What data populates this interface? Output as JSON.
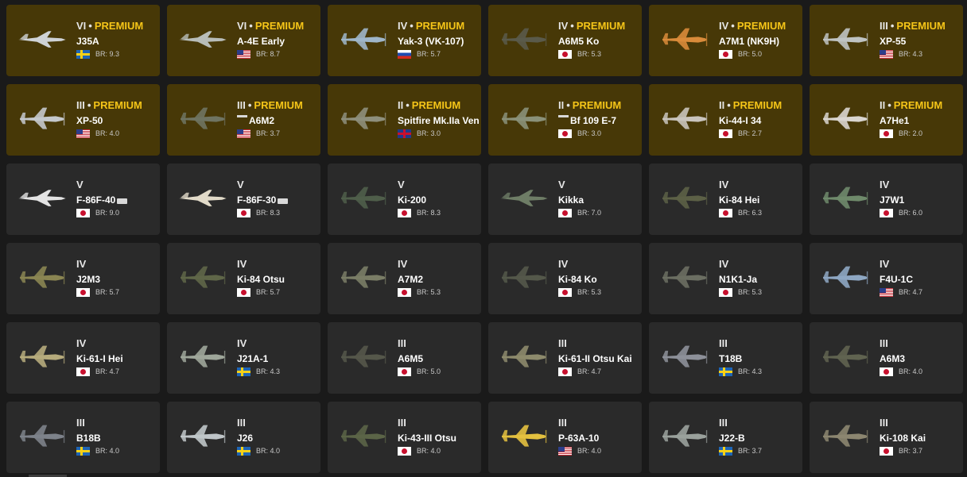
{
  "vehicles": [
    {
      "rank": "VI",
      "premium": true,
      "premium_label": "PREMIUM",
      "name": "J35A",
      "country": "se",
      "br": "BR: 9.3",
      "icon": "jet-aircraft-icon",
      "color": "#cfd3d6"
    },
    {
      "rank": "VI",
      "premium": true,
      "premium_label": "PREMIUM",
      "name": "A-4E Early",
      "country": "us",
      "br": "BR: 8.7",
      "icon": "jet-aircraft-icon",
      "color": "#b8bdb9"
    },
    {
      "rank": "IV",
      "premium": true,
      "premium_label": "PREMIUM",
      "name": "Yak-3 (VK-107)",
      "country": "ru",
      "br": "BR: 5.7",
      "icon": "prop-aircraft-icon",
      "color": "#9fb6c9"
    },
    {
      "rank": "IV",
      "premium": true,
      "premium_label": "PREMIUM",
      "name": "A6M5 Ko",
      "country": "jp",
      "br": "BR: 5.3",
      "icon": "prop-aircraft-icon",
      "color": "#5a5a4a"
    },
    {
      "rank": "IV",
      "premium": true,
      "premium_label": "PREMIUM",
      "name": "A7M1 (NK9H)",
      "country": "jp",
      "br": "BR: 5.0",
      "icon": "prop-aircraft-icon",
      "color": "#d98b3a"
    },
    {
      "rank": "III",
      "premium": true,
      "premium_label": "PREMIUM",
      "name": "XP-55",
      "country": "us",
      "br": "BR: 4.3",
      "icon": "prop-aircraft-icon",
      "color": "#bfc3c2"
    },
    {
      "rank": "III",
      "premium": true,
      "premium_label": "PREMIUM",
      "name": "XP-50",
      "country": "us",
      "br": "BR: 4.0",
      "icon": "prop-aircraft-icon",
      "color": "#c4c8cc"
    },
    {
      "rank": "III",
      "premium": true,
      "premium_label": "PREMIUM",
      "name": "A6M2",
      "country": "us",
      "br": "BR: 3.7",
      "icon": "prop-aircraft-icon",
      "color": "#6f7462",
      "prefix_icon": true
    },
    {
      "rank": "II",
      "premium": true,
      "premium_label": "PREMIUM",
      "name": "Spitfire Mk.IIa Ven",
      "country": "gb",
      "br": "BR: 3.0",
      "icon": "prop-aircraft-icon",
      "color": "#8e8f7c"
    },
    {
      "rank": "II",
      "premium": true,
      "premium_label": "PREMIUM",
      "name": "Bf 109 E-7",
      "country": "jp",
      "br": "BR: 3.0",
      "icon": "prop-aircraft-icon",
      "color": "#8a9179",
      "prefix_icon": true
    },
    {
      "rank": "II",
      "premium": true,
      "premium_label": "PREMIUM",
      "name": "Ki-44-I 34",
      "country": "jp",
      "br": "BR: 2.7",
      "icon": "prop-aircraft-icon",
      "color": "#c9c4bd"
    },
    {
      "rank": "II",
      "premium": true,
      "premium_label": "PREMIUM",
      "name": "A7He1",
      "country": "jp",
      "br": "BR: 2.0",
      "icon": "prop-aircraft-icon",
      "color": "#d9d5cf"
    },
    {
      "rank": "V",
      "premium": false,
      "premium_label": "",
      "name": "F-86F-40",
      "country": "jp",
      "br": "BR: 9.0",
      "icon": "jet-aircraft-icon",
      "color": "#e3e3e3",
      "suffix_icon": true
    },
    {
      "rank": "V",
      "premium": false,
      "premium_label": "",
      "name": "F-86F-30",
      "country": "jp",
      "br": "BR: 8.3",
      "icon": "jet-aircraft-icon",
      "color": "#e2dbc9",
      "suffix_icon": true
    },
    {
      "rank": "V",
      "premium": false,
      "premium_label": "",
      "name": "Ki-200",
      "country": "jp",
      "br": "BR: 8.3",
      "icon": "prop-aircraft-icon",
      "color": "#4f5e4a"
    },
    {
      "rank": "V",
      "premium": false,
      "premium_label": "",
      "name": "Kikka",
      "country": "jp",
      "br": "BR: 7.0",
      "icon": "jet-aircraft-icon",
      "color": "#6e7d66"
    },
    {
      "rank": "IV",
      "premium": false,
      "premium_label": "",
      "name": "Ki-84 Hei",
      "country": "jp",
      "br": "BR: 6.3",
      "icon": "prop-aircraft-icon",
      "color": "#5c6046"
    },
    {
      "rank": "IV",
      "premium": false,
      "premium_label": "",
      "name": "J7W1",
      "country": "jp",
      "br": "BR: 6.0",
      "icon": "prop-aircraft-icon",
      "color": "#6f8a6b"
    },
    {
      "rank": "IV",
      "premium": false,
      "premium_label": "",
      "name": "J2M3",
      "country": "jp",
      "br": "BR: 5.7",
      "icon": "prop-aircraft-icon",
      "color": "#8a8552"
    },
    {
      "rank": "IV",
      "premium": false,
      "premium_label": "",
      "name": "Ki-84 Otsu",
      "country": "jp",
      "br": "BR: 5.7",
      "icon": "prop-aircraft-icon",
      "color": "#5f6648"
    },
    {
      "rank": "IV",
      "premium": false,
      "premium_label": "",
      "name": "A7M2",
      "country": "jp",
      "br": "BR: 5.3",
      "icon": "prop-aircraft-icon",
      "color": "#7a7d66"
    },
    {
      "rank": "IV",
      "premium": false,
      "premium_label": "",
      "name": "Ki-84 Ko",
      "country": "jp",
      "br": "BR: 5.3",
      "icon": "prop-aircraft-icon",
      "color": "#54584a"
    },
    {
      "rank": "IV",
      "premium": false,
      "premium_label": "",
      "name": "N1K1-Ja",
      "country": "jp",
      "br": "BR: 5.3",
      "icon": "prop-aircraft-icon",
      "color": "#6b6e62"
    },
    {
      "rank": "IV",
      "premium": false,
      "premium_label": "",
      "name": "F4U-1C",
      "country": "us",
      "br": "BR: 4.7",
      "icon": "prop-aircraft-icon",
      "color": "#8ea7c3"
    },
    {
      "rank": "IV",
      "premium": false,
      "premium_label": "",
      "name": "Ki-61-I Hei",
      "country": "jp",
      "br": "BR: 4.7",
      "icon": "prop-aircraft-icon",
      "color": "#b6ab7c"
    },
    {
      "rank": "IV",
      "premium": false,
      "premium_label": "",
      "name": "J21A-1",
      "country": "se",
      "br": "BR: 4.3",
      "icon": "prop-aircraft-icon",
      "color": "#9ea69a"
    },
    {
      "rank": "III",
      "premium": false,
      "premium_label": "",
      "name": "A6M5",
      "country": "jp",
      "br": "BR: 5.0",
      "icon": "prop-aircraft-icon",
      "color": "#55574a"
    },
    {
      "rank": "III",
      "premium": false,
      "premium_label": "",
      "name": "Ki-61-II Otsu Kai",
      "country": "jp",
      "br": "BR: 4.7",
      "icon": "prop-aircraft-icon",
      "color": "#8d8a6c"
    },
    {
      "rank": "III",
      "premium": false,
      "premium_label": "",
      "name": "T18B",
      "country": "se",
      "br": "BR: 4.3",
      "icon": "prop-aircraft-icon",
      "color": "#8d9099"
    },
    {
      "rank": "III",
      "premium": false,
      "premium_label": "",
      "name": "A6M3",
      "country": "jp",
      "br": "BR: 4.0",
      "icon": "prop-aircraft-icon",
      "color": "#606350"
    },
    {
      "rank": "III",
      "premium": false,
      "premium_label": "",
      "name": "B18B",
      "country": "se",
      "br": "BR: 4.0",
      "icon": "prop-aircraft-icon",
      "color": "#7d828a"
    },
    {
      "rank": "III",
      "premium": false,
      "premium_label": "",
      "name": "J26",
      "country": "se",
      "br": "BR: 4.0",
      "icon": "prop-aircraft-icon",
      "color": "#bfc5c8"
    },
    {
      "rank": "III",
      "premium": false,
      "premium_label": "",
      "name": "Ki-43-III Otsu",
      "country": "jp",
      "br": "BR: 4.0",
      "icon": "prop-aircraft-icon",
      "color": "#5b6447"
    },
    {
      "rank": "III",
      "premium": false,
      "premium_label": "",
      "name": "P-63A-10",
      "country": "us",
      "br": "BR: 4.0",
      "icon": "prop-aircraft-icon",
      "color": "#e3c03f"
    },
    {
      "rank": "III",
      "premium": false,
      "premium_label": "",
      "name": "J22-B",
      "country": "se",
      "br": "BR: 3.7",
      "icon": "prop-aircraft-icon",
      "color": "#9aa19c"
    },
    {
      "rank": "III",
      "premium": false,
      "premium_label": "",
      "name": "Ki-108 Kai",
      "country": "jp",
      "br": "BR: 3.7",
      "icon": "prop-aircraft-icon",
      "color": "#8c8670"
    }
  ]
}
